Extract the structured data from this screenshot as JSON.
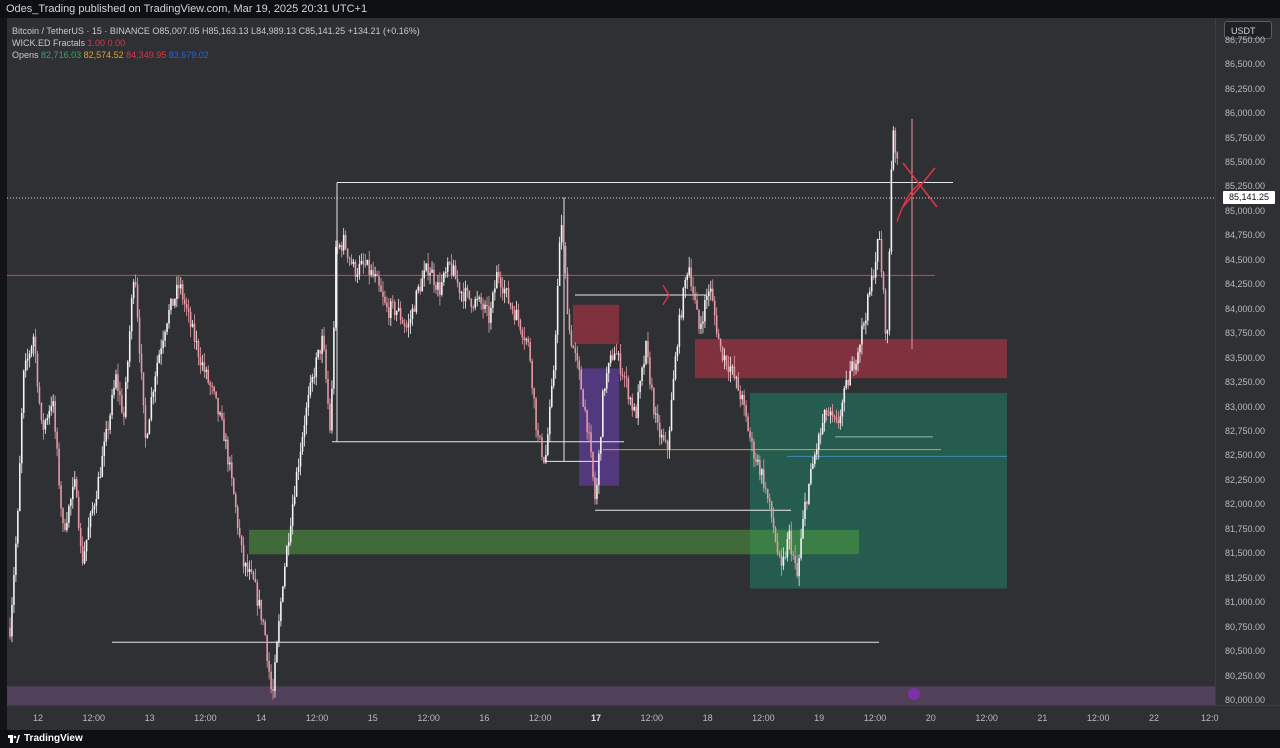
{
  "header": {
    "published_text": "Odes_Trading published on TradingView.com, Mar 19, 2025 20:31 UTC+1"
  },
  "legend": {
    "symbol": "Bitcoin / TetherUS · 15 · BINANCE",
    "o_label": "O",
    "o_value": "85,007.05",
    "h_label": "H",
    "h_value": "85,163.13",
    "l_label": "L",
    "l_value": "84,989.13",
    "c_label": "C",
    "c_value": "85,141.25",
    "change": "+134.21 (+0.16%)",
    "fractals_name": "WICK.ED Fractals",
    "fractals_v1": "1.00",
    "fractals_v2": "0.00",
    "opens_name": "Opens",
    "open1": "82,716.03",
    "open2": "82,574.52",
    "open3": "84,349.95",
    "open4": "83,679.02"
  },
  "price_axis": {
    "currency": "USDT",
    "current_price": "85,141.25",
    "ticks": [
      "86,750.00",
      "86,500.00",
      "86,250.00",
      "86,000.00",
      "85,750.00",
      "85,500.00",
      "85,250.00",
      "85,000.00",
      "84,750.00",
      "84,500.00",
      "84,250.00",
      "84,000.00",
      "83,750.00",
      "83,500.00",
      "83,250.00",
      "83,000.00",
      "82,750.00",
      "82,500.00",
      "82,250.00",
      "82,000.00",
      "81,750.00",
      "81,500.00",
      "81,250.00",
      "81,000.00",
      "80,750.00",
      "80,500.00",
      "80,250.00",
      "80,000.00"
    ]
  },
  "time_axis": {
    "ticks": [
      "12",
      "12:00",
      "13",
      "12:00",
      "14",
      "12:00",
      "15",
      "12:00",
      "16",
      "12:00",
      "17",
      "12:00",
      "18",
      "12:00",
      "19",
      "12:00",
      "20",
      "12:00",
      "21",
      "12:00",
      "22",
      "12:0"
    ]
  },
  "footer": {
    "brand": "TradingView"
  },
  "colors": {
    "background": "#2f3033",
    "candle": "#e79aa6",
    "candle_up": "#ffffff",
    "supply_zone": "#b83246",
    "demand_zone": "#1f7a63",
    "green_zone": "#4f9a3f",
    "purple_zone": "#6a3fb0"
  },
  "chart_data": {
    "type": "candlestick",
    "symbol": "Bitcoin / TetherUS",
    "interval": "15",
    "exchange": "BINANCE",
    "ylim": [
      80000,
      86900
    ],
    "x_range": [
      "Mar 12",
      "Mar 22"
    ],
    "last_price": 85141.25,
    "price_path": [
      [
        0,
        80750
      ],
      [
        3,
        81900
      ],
      [
        5,
        83300
      ],
      [
        9,
        83750
      ],
      [
        12,
        82750
      ],
      [
        16,
        83100
      ],
      [
        20,
        81750
      ],
      [
        25,
        82250
      ],
      [
        27,
        81400
      ],
      [
        33,
        82200
      ],
      [
        36,
        82650
      ],
      [
        40,
        83300
      ],
      [
        43,
        82900
      ],
      [
        47,
        84500
      ],
      [
        51,
        82650
      ],
      [
        55,
        83400
      ],
      [
        59,
        83900
      ],
      [
        64,
        84250
      ],
      [
        68,
        83850
      ],
      [
        73,
        83400
      ],
      [
        77,
        83100
      ],
      [
        81,
        82700
      ],
      [
        85,
        82000
      ],
      [
        88,
        81400
      ],
      [
        92,
        81200
      ],
      [
        96,
        80750
      ],
      [
        99,
        80000
      ],
      [
        103,
        81250
      ],
      [
        107,
        82100
      ],
      [
        111,
        82850
      ],
      [
        115,
        83400
      ],
      [
        118,
        83700
      ],
      [
        121,
        82700
      ],
      [
        123,
        84600
      ],
      [
        126,
        84700
      ],
      [
        130,
        84400
      ],
      [
        134,
        84450
      ],
      [
        138,
        84300
      ],
      [
        142,
        84000
      ],
      [
        146,
        84000
      ],
      [
        150,
        83800
      ],
      [
        154,
        84200
      ],
      [
        158,
        84450
      ],
      [
        162,
        84200
      ],
      [
        166,
        84450
      ],
      [
        170,
        84200
      ],
      [
        174,
        84100
      ],
      [
        178,
        84050
      ],
      [
        181,
        83900
      ],
      [
        184,
        84400
      ],
      [
        188,
        84100
      ],
      [
        192,
        83900
      ],
      [
        196,
        83600
      ],
      [
        199,
        82700
      ],
      [
        202,
        82450
      ],
      [
        205,
        83300
      ],
      [
        208,
        84950
      ],
      [
        211,
        83800
      ],
      [
        215,
        83300
      ],
      [
        218,
        82800
      ],
      [
        221,
        82000
      ],
      [
        224,
        83200
      ],
      [
        228,
        83600
      ],
      [
        232,
        83300
      ],
      [
        236,
        82900
      ],
      [
        240,
        83600
      ],
      [
        244,
        82800
      ],
      [
        248,
        82550
      ],
      [
        252,
        83750
      ],
      [
        256,
        84500
      ],
      [
        260,
        83800
      ],
      [
        264,
        84250
      ],
      [
        268,
        83600
      ],
      [
        272,
        83400
      ],
      [
        276,
        83100
      ],
      [
        280,
        82600
      ],
      [
        284,
        82300
      ],
      [
        288,
        81800
      ],
      [
        291,
        81300
      ],
      [
        294,
        81700
      ],
      [
        297,
        81250
      ],
      [
        300,
        82000
      ],
      [
        304,
        82550
      ],
      [
        308,
        82950
      ],
      [
        312,
        82800
      ],
      [
        316,
        83250
      ],
      [
        320,
        83600
      ],
      [
        324,
        84100
      ],
      [
        328,
        84750
      ],
      [
        331,
        83600
      ],
      [
        333,
        85950
      ],
      [
        336,
        85141.25
      ]
    ],
    "horizontal_levels": [
      {
        "price": 85141.25,
        "style": "dotted",
        "label": "85,141.25"
      },
      {
        "price": 84350,
        "style": "solid",
        "color": "#d9364a"
      }
    ],
    "zones": [
      {
        "kind": "supply",
        "price_top": 83700,
        "price_bottom": 83300,
        "color": "#b83246"
      },
      {
        "kind": "supply",
        "price_top": 84050,
        "price_bottom": 83650,
        "color": "#b83246"
      },
      {
        "kind": "demand",
        "price_top": 83150,
        "price_bottom": 81150,
        "color": "#1f7a63"
      },
      {
        "kind": "demand",
        "price_top": 81750,
        "price_bottom": 81500,
        "color": "#4f9a3f"
      },
      {
        "kind": "imbalance",
        "price_top": 83400,
        "price_bottom": 82200,
        "color": "#6a3fb0"
      }
    ]
  }
}
